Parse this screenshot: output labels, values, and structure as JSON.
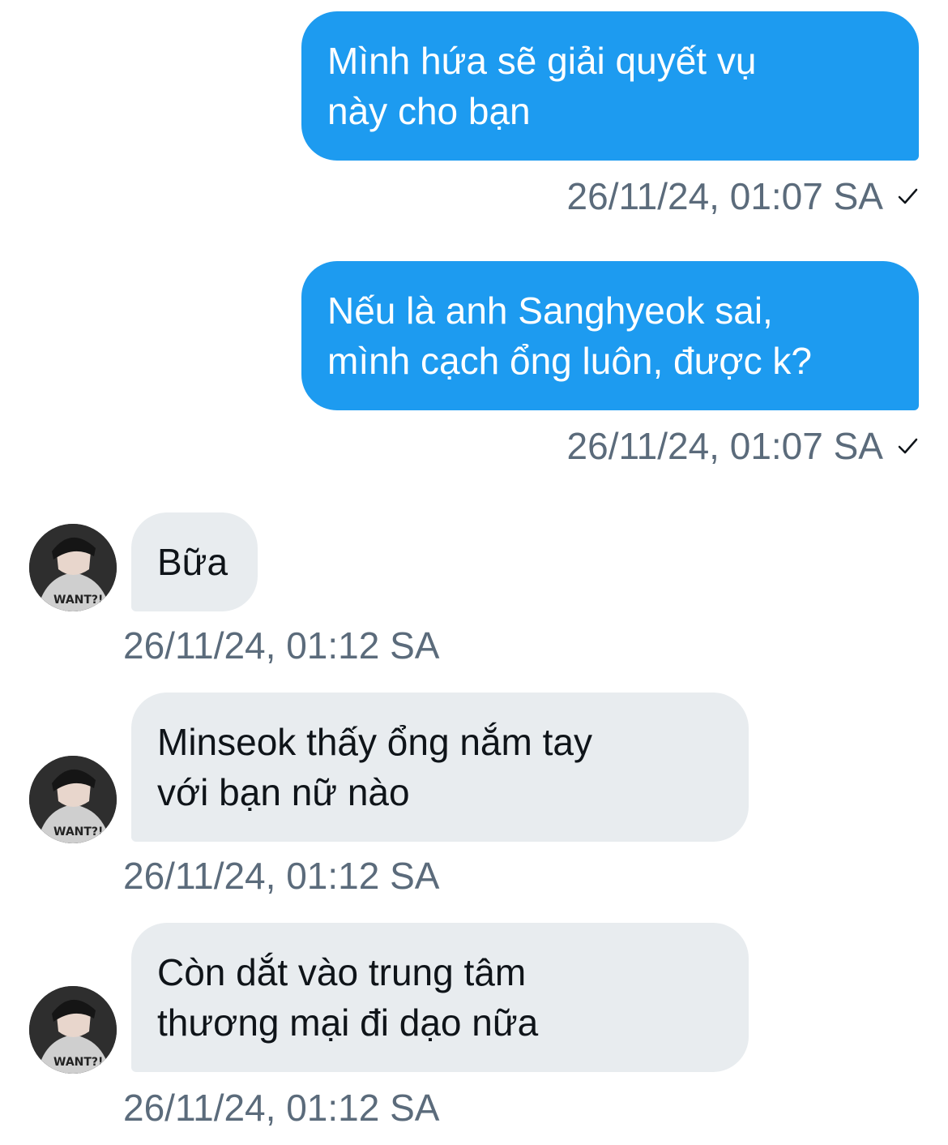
{
  "messages": [
    {
      "direction": "outgoing",
      "text": "Mình hứa sẽ giải quyết vụ\nnày cho bạn",
      "timestamp": "26/11/24, 01:07 SA",
      "read_receipt": "check-icon"
    },
    {
      "direction": "outgoing",
      "text": "Nếu là anh Sanghyeok sai,\nmình cạch ổng luôn, được k?",
      "timestamp": "26/11/24, 01:07 SA",
      "read_receipt": "check-icon"
    },
    {
      "direction": "incoming",
      "text": "Bữa",
      "timestamp": "26/11/24, 01:12 SA",
      "avatar": "contact-avatar"
    },
    {
      "direction": "incoming",
      "text": "Minseok thấy ổng nắm tay\nvới bạn nữ nào",
      "timestamp": "26/11/24, 01:12 SA",
      "avatar": "contact-avatar"
    },
    {
      "direction": "incoming",
      "text": "Còn dắt vào trung tâm\nthương mại đi dạo nữa",
      "timestamp": "26/11/24, 01:12 SA",
      "avatar": "contact-avatar"
    }
  ],
  "colors": {
    "outgoing_bubble": "#1d9bf0",
    "incoming_bubble": "#e8ecef",
    "timestamp_text": "#5b6b7b"
  }
}
